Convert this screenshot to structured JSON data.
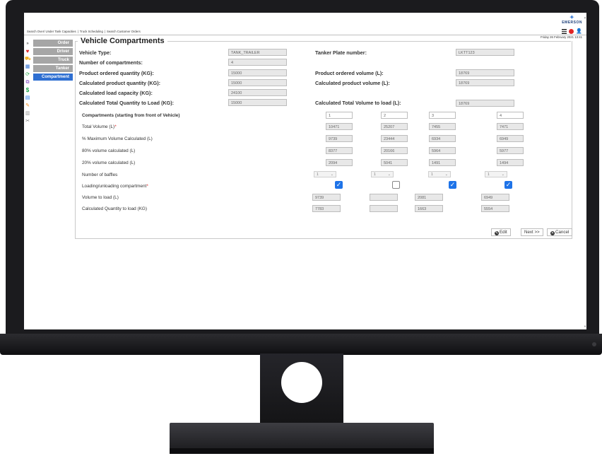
{
  "app": {
    "brand": "EMERSON",
    "datetime": "Friday 26 February 2021 13:41"
  },
  "breadcrumb": [
    "Search Over/ Under Tank Capacities",
    "Truck Scheduling",
    "Search Customer Orders"
  ],
  "steps": [
    "Order",
    "Driver",
    "Truck",
    "Tanker",
    "Compartment"
  ],
  "icons": [
    "heart-icon",
    "truck-icon",
    "calendar-icon",
    "refresh-icon",
    "link-icon",
    "dollar-icon",
    "report-icon",
    "pencil-icon",
    "grid-icon",
    "wrench-icon"
  ],
  "panel": {
    "title": "Vehicle Compartments"
  },
  "fields": {
    "vehicle_type": {
      "label": "Vehicle Type:",
      "value": "TANK_TRAILER"
    },
    "num_compartments": {
      "label": "Number of compartments:",
      "value": "4"
    },
    "prod_qty": {
      "label": "Product ordered quantity (KG):",
      "value": "15000"
    },
    "calc_prod_qty": {
      "label": "Calculated product quantity (KG):",
      "value": "15000"
    },
    "calc_load_cap": {
      "label": "Calculated load capacity (KG):",
      "value": "24100"
    },
    "calc_total_qty": {
      "label": "Calculated Total Quantity to Load (KG):",
      "value": "15000"
    },
    "plate": {
      "label": "Tanker Plate number:",
      "value": "LKTT123"
    },
    "prod_vol": {
      "label": "Product ordered volume (L):",
      "value": "18769"
    },
    "calc_prod_vol": {
      "label": "Calculated product volume (L):",
      "value": "18769"
    },
    "calc_total_vol": {
      "label": "Calculated Total Volume to load (L):",
      "value": "18769"
    }
  },
  "table": {
    "compartments_label": "Compartments (starting from front of Vehicle)",
    "compartments": [
      "1",
      "2",
      "3",
      "4"
    ],
    "total_volume_label": "Total Volume (L)",
    "total_volume": [
      "10471",
      "25207",
      "7455",
      "7471"
    ],
    "max_volume_label": "% Maximum Volume Calculated (L)",
    "max_volume": [
      "9739",
      "23444",
      "6934",
      "6949"
    ],
    "vol80_label": "80% volume calculated (L)",
    "vol80": [
      "8377",
      "20166",
      "5964",
      "5977"
    ],
    "vol20_label": "20% volume calculated (L)",
    "vol20": [
      "2094",
      "5041",
      "1491",
      "1494"
    ],
    "baffles_label": "Number of baffles",
    "baffles": [
      "1",
      "1",
      "1",
      "1"
    ],
    "loading_label": "Loading/unloading compartment",
    "loading": [
      true,
      false,
      true,
      true
    ],
    "vol_to_load_label": "Volume to load (L)",
    "vol_to_load": [
      "9739",
      "",
      "2081",
      "6949"
    ],
    "qty_to_load_label": "Calculated Quantity to load (KG)",
    "qty_to_load": [
      "7783",
      "",
      "1663",
      "5554"
    ]
  },
  "buttons": {
    "edit": "Edit",
    "next": "Next >>",
    "cancel": "Cancel"
  }
}
